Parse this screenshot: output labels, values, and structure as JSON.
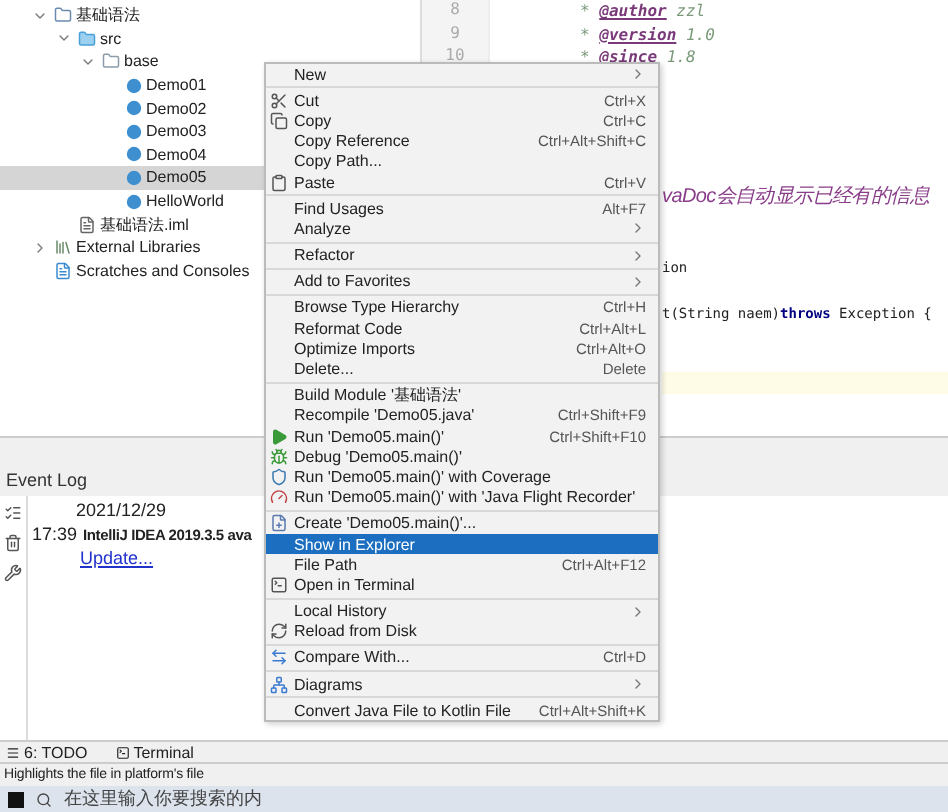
{
  "project_tree": [
    {
      "label": "基础语法",
      "kind": "module",
      "expanded": true,
      "selected": false,
      "children": [
        {
          "label": "src",
          "kind": "source-folder",
          "expanded": true,
          "selected": false,
          "children": [
            {
              "label": "base",
              "kind": "package",
              "expanded": true,
              "selected": false,
              "children": [
                {
                  "label": "Demo01",
                  "kind": "class",
                  "selected": false
                },
                {
                  "label": "Demo02",
                  "kind": "class",
                  "selected": false
                },
                {
                  "label": "Demo03",
                  "kind": "class",
                  "selected": false
                },
                {
                  "label": "Demo04",
                  "kind": "class",
                  "selected": false
                },
                {
                  "label": "Demo05",
                  "kind": "class",
                  "selected": true
                },
                {
                  "label": "HelloWorld",
                  "kind": "class",
                  "selected": false
                }
              ]
            }
          ]
        },
        {
          "label": "基础语法.iml",
          "kind": "file",
          "selected": false
        }
      ]
    },
    {
      "label": "External Libraries",
      "kind": "library",
      "expanded": false,
      "selected": false
    },
    {
      "label": "Scratches and Consoles",
      "kind": "scratches",
      "selected": false
    }
  ],
  "editor": {
    "line_numbers": [
      "8",
      "9",
      "10"
    ],
    "lines": [
      {
        "kind": "doc",
        "text": "* **@author** zzl"
      },
      {
        "kind": "doc",
        "text": "* **@version** 1.0"
      },
      {
        "kind": "doc",
        "text": "* **@since** 1.8"
      },
      {
        "kind": "blank"
      },
      {
        "kind": "blank"
      },
      {
        "kind": "blank"
      },
      {
        "kind": "blank"
      },
      {
        "kind": "blank"
      },
      {
        "kind": "doc-cut",
        "text": "vaDoc会自动显示已经有的信息"
      },
      {
        "kind": "blank"
      },
      {
        "kind": "blank"
      },
      {
        "kind": "code-cut",
        "text": "ion"
      },
      {
        "kind": "blank"
      },
      {
        "kind": "code-cut",
        "text": "t(String naem)**throws** Exception {"
      },
      {
        "kind": "blank"
      },
      {
        "kind": "blank"
      },
      {
        "kind": "current"
      }
    ]
  },
  "context_menu": [
    [
      {
        "label": "New",
        "submenu": true,
        "selected": false,
        "kind": "plain"
      }
    ],
    [
      {
        "label": "Cut",
        "shortcut": "Ctrl+X",
        "kind": "cut",
        "selected": false
      },
      {
        "label": "Copy",
        "shortcut": "Ctrl+C",
        "kind": "copy",
        "selected": false
      },
      {
        "label": "Copy Reference",
        "shortcut": "Ctrl+Alt+Shift+C",
        "kind": "plain",
        "selected": false
      },
      {
        "label": "Copy Path...",
        "kind": "plain",
        "selected": false
      },
      {
        "label": "Paste",
        "shortcut": "Ctrl+V",
        "kind": "paste",
        "selected": false
      }
    ],
    [
      {
        "label": "Find Usages",
        "shortcut": "Alt+F7",
        "kind": "plain",
        "selected": false
      },
      {
        "label": "Analyze",
        "submenu": true,
        "kind": "plain",
        "selected": false
      }
    ],
    [
      {
        "label": "Refactor",
        "submenu": true,
        "kind": "plain",
        "selected": false
      }
    ],
    [
      {
        "label": "Add to Favorites",
        "submenu": true,
        "kind": "plain",
        "selected": false
      }
    ],
    [
      {
        "label": "Browse Type Hierarchy",
        "shortcut": "Ctrl+H",
        "kind": "plain",
        "selected": false
      },
      {
        "label": "Reformat Code",
        "shortcut": "Ctrl+Alt+L",
        "kind": "plain",
        "selected": false
      },
      {
        "label": "Optimize Imports",
        "shortcut": "Ctrl+Alt+O",
        "kind": "plain",
        "selected": false
      },
      {
        "label": "Delete...",
        "shortcut": "Delete",
        "kind": "plain",
        "selected": false
      }
    ],
    [
      {
        "label": "Build Module '基础语法'",
        "kind": "plain",
        "selected": false
      },
      {
        "label": "Recompile 'Demo05.java'",
        "shortcut": "Ctrl+Shift+F9",
        "kind": "plain",
        "selected": false
      },
      {
        "label": "Run 'Demo05.main()'",
        "shortcut": "Ctrl+Shift+F10",
        "kind": "run",
        "selected": false
      },
      {
        "label": "Debug 'Demo05.main()'",
        "kind": "debug",
        "selected": false
      },
      {
        "label": "Run 'Demo05.main()' with Coverage",
        "kind": "coverage",
        "selected": false
      },
      {
        "label": "Run 'Demo05.main()' with 'Java Flight Recorder'",
        "kind": "profiler",
        "selected": false
      }
    ],
    [
      {
        "label": "Create 'Demo05.main()'...",
        "kind": "create",
        "selected": false
      },
      {
        "label": "Show in Explorer",
        "kind": "plain",
        "selected": true
      },
      {
        "label": "File Path",
        "shortcut": "Ctrl+Alt+F12",
        "kind": "plain",
        "selected": false
      },
      {
        "label": "Open in Terminal",
        "kind": "terminal",
        "selected": false
      }
    ],
    [
      {
        "label": "Local History",
        "submenu": true,
        "kind": "plain",
        "selected": false
      },
      {
        "label": "Reload from Disk",
        "kind": "reload",
        "selected": false
      }
    ],
    [
      {
        "label": "Compare With...",
        "shortcut": "Ctrl+D",
        "kind": "compare",
        "selected": false
      }
    ],
    [
      {
        "label": "Diagrams",
        "submenu": true,
        "kind": "diagram",
        "selected": false
      }
    ],
    [
      {
        "label": "Convert Java File to Kotlin File",
        "shortcut": "Ctrl+Alt+Shift+K",
        "kind": "plain",
        "selected": false
      }
    ]
  ],
  "event_log": {
    "title": "Event Log",
    "date": "2021/12/29",
    "time": "17:39",
    "message": "IntelliJ IDEA 2019.3.5 ava",
    "link": "Update..."
  },
  "tool_tabs": [
    "6: TODO",
    "Terminal"
  ],
  "status_bar": "Highlights the file in platform's file",
  "taskbar": {
    "search_placeholder": "在这里输入你要搜索的内"
  }
}
